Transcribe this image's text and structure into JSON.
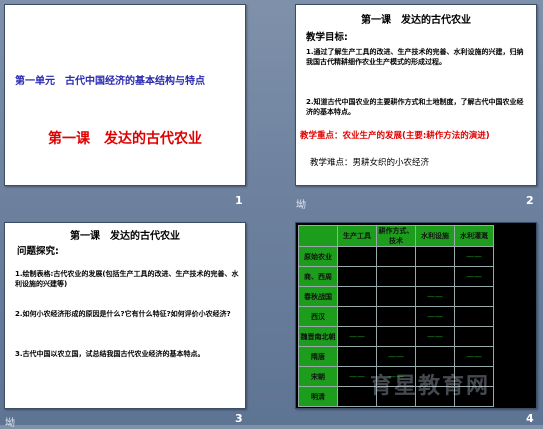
{
  "slides": [
    {
      "number": "1",
      "unit_title": "第一单元　古代中国经济的基本结构与特点",
      "lesson_title": "第一课　发达的古代农业"
    },
    {
      "number": "2",
      "note": "坳",
      "title": "第一课　发达的古代农业",
      "goal_label": "教学目标:",
      "goal_1": "1.通过了解生产工具的改进、生产技术的完善、水利设施的兴建，归纳我国古代精耕细作农业生产模式的形成过程。",
      "goal_2": "2.知道古代中国农业的主要耕作方式和土地制度，了解古代中国农业经济的基本特点。",
      "key_point": "教学重点：农业生产的发展(主要:耕作方法的演进)",
      "difficulty": "教学难点：男耕女织的小农经济"
    },
    {
      "number": "3",
      "note": "坳",
      "title": "第一课　发达的古代农业",
      "question_label": "问题探究:",
      "q1": "1.绘制表格:古代农业的发展(包括生产工具的改进、生产技术的完善、水利设施的兴建等)",
      "q2": "2.如何小农经济形成的原因是什么?它有什么特征?如何评价小农经济?",
      "q3": "3.古代中国以农立国，试总结我国古代农业经济的基本特点。"
    },
    {
      "number": "4",
      "headers": [
        "",
        "生产工具",
        "耕作方式、技术",
        "水利设施",
        "水利灌溉"
      ],
      "rows": [
        {
          "label": "原始农业",
          "cells": [
            "",
            "",
            "",
            "——"
          ]
        },
        {
          "label": "商、西周",
          "cells": [
            "",
            "",
            "",
            "——"
          ]
        },
        {
          "label": "春秋战国",
          "cells": [
            "",
            "",
            "——",
            ""
          ]
        },
        {
          "label": "西汉",
          "cells": [
            "",
            "",
            "——",
            ""
          ]
        },
        {
          "label": "魏晋南北朝",
          "cells": [
            "——",
            "",
            "——",
            ""
          ]
        },
        {
          "label": "隋唐",
          "cells": [
            "",
            "——",
            "",
            "——"
          ]
        },
        {
          "label": "宋朝",
          "cells": [
            "——",
            "——",
            "",
            ""
          ]
        },
        {
          "label": "明清",
          "cells": [
            "",
            "",
            "",
            ""
          ]
        }
      ]
    }
  ],
  "watermark": "育星教育网"
}
